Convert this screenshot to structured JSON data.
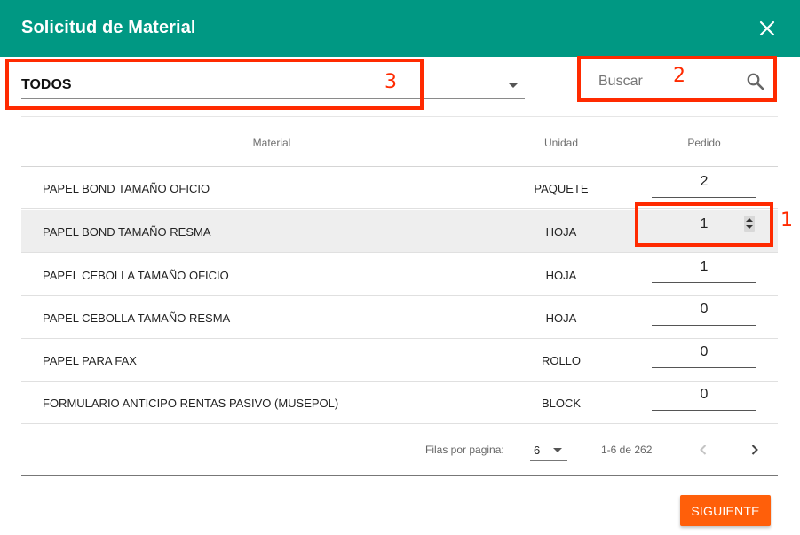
{
  "dialog": {
    "title": "Solicitud de Material",
    "close_icon": "close-icon"
  },
  "filter": {
    "selected": "TODOS"
  },
  "search": {
    "placeholder": "Buscar",
    "value": "",
    "icon": "search-icon"
  },
  "table": {
    "headers": {
      "material": "Material",
      "unit": "Unidad",
      "order": "Pedido"
    },
    "rows": [
      {
        "material": "PAPEL BOND TAMAÑO OFICIO",
        "unit": "PAQUETE",
        "qty": "2"
      },
      {
        "material": "PAPEL BOND TAMAÑO RESMA",
        "unit": "HOJA",
        "qty": "1"
      },
      {
        "material": "PAPEL CEBOLLA TAMAÑO OFICIO",
        "unit": "HOJA",
        "qty": "1"
      },
      {
        "material": "PAPEL CEBOLLA TAMAÑO RESMA",
        "unit": "HOJA",
        "qty": "0"
      },
      {
        "material": "PAPEL PARA FAX",
        "unit": "ROLLO",
        "qty": "0"
      },
      {
        "material": "FORMULARIO ANTICIPO RENTAS PASIVO (MUSEPOL)",
        "unit": "BLOCK",
        "qty": "0"
      }
    ]
  },
  "pagination": {
    "rows_per_page_label": "Filas por pagina:",
    "rows_per_page": "6",
    "range": "1-6 de 262",
    "prev_icon": "chevron-left-icon",
    "next_icon": "chevron-right-icon"
  },
  "actions": {
    "next_label": "SIGUIENTE"
  },
  "annotations": {
    "one": "1",
    "two": "2",
    "three": "3",
    "color": "#ff2a00"
  },
  "colors": {
    "header": "#009883",
    "accent_button": "#ff5f0a"
  }
}
